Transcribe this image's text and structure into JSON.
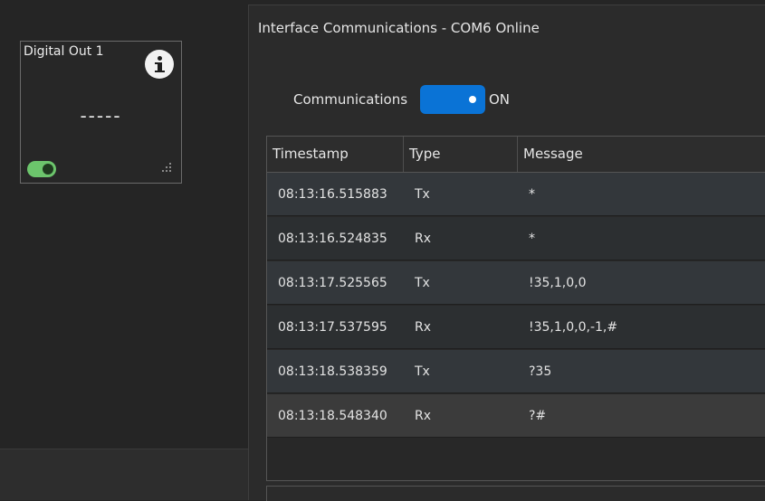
{
  "widget": {
    "title": "Digital Out 1",
    "value": "-----",
    "toggle_on": true,
    "toggle_color": "#6cc56c"
  },
  "panel": {
    "title": "Interface Communications - COM6 Online",
    "communications_label": "Communications",
    "communications_state": "ON",
    "toggle_color": "#0a73d6"
  },
  "table": {
    "columns": [
      "Timestamp",
      "Type",
      "Message"
    ],
    "rows": [
      {
        "timestamp": "08:13:16.515883",
        "type": "Tx",
        "message": "*"
      },
      {
        "timestamp": "08:13:16.524835",
        "type": "Rx",
        "message": "*"
      },
      {
        "timestamp": "08:13:17.525565",
        "type": "Tx",
        "message": "!35,1,0,0"
      },
      {
        "timestamp": "08:13:17.537595",
        "type": "Rx",
        "message": "!35,1,0,0,-1,#"
      },
      {
        "timestamp": "08:13:18.538359",
        "type": "Tx",
        "message": "?35"
      },
      {
        "timestamp": "08:13:18.548340",
        "type": "Rx",
        "message": "?#"
      }
    ]
  }
}
